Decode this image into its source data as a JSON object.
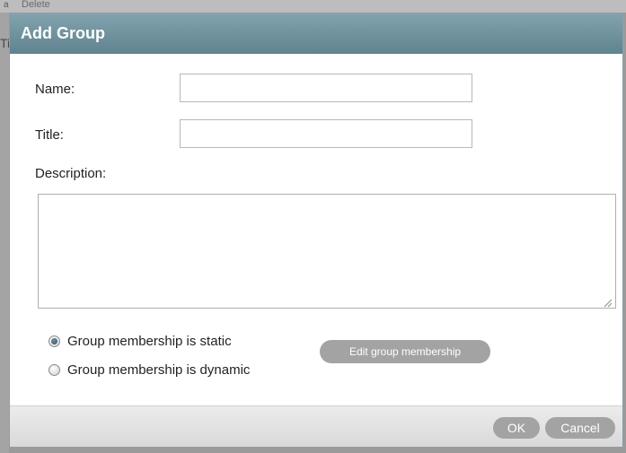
{
  "background": {
    "menu_item": "Delete",
    "bullet": "a",
    "left_fragment": "Ti"
  },
  "dialog": {
    "title": "Add Group",
    "name_label": "Name:",
    "name_value": "",
    "title_label": "Title:",
    "title_value": "",
    "description_label": "Description:",
    "description_value": "",
    "membership": {
      "static_label": "Group membership is static",
      "dynamic_label": "Group membership is dynamic",
      "selected": "static"
    },
    "edit_membership_button": "Edit group membership",
    "ok_button": "OK",
    "cancel_button": "Cancel"
  },
  "colors": {
    "titlebar": "#6e919c",
    "button": "#a3a3a3",
    "radio_selected": "#3b5f78"
  }
}
